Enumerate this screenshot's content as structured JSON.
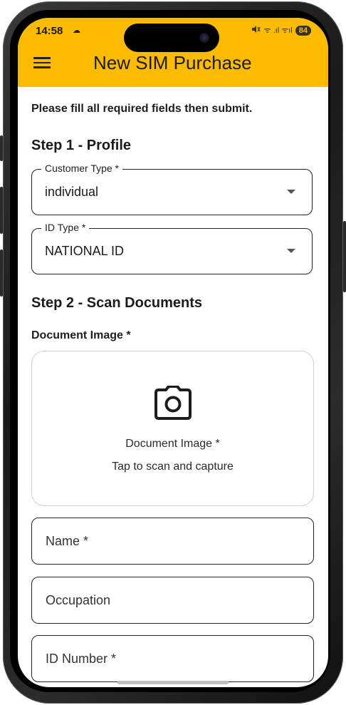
{
  "status_bar": {
    "time": "14:58",
    "notif_glyph": "☁",
    "signal_text": "ᯤ .ıl ᯤıl",
    "battery": "84"
  },
  "app_bar": {
    "title": "New SIM Purchase",
    "menu_icon": "hamburger-icon",
    "background_color": "#FDBB00"
  },
  "form": {
    "intro": "Please fill all required fields then submit.",
    "step1_title": "Step 1 - Profile",
    "customer_type": {
      "label": "Customer Type *",
      "value": "individual"
    },
    "id_type": {
      "label": "ID Type *",
      "value": "NATIONAL ID"
    },
    "step2_title": "Step 2 - Scan Documents",
    "document_label": "Document Image *",
    "document_box": {
      "icon": "camera-icon",
      "title": "Document Image *",
      "hint": "Tap to scan and capture"
    },
    "name_placeholder": "Name *",
    "occupation_placeholder": "Occupation",
    "id_number_placeholder": "ID Number *"
  }
}
